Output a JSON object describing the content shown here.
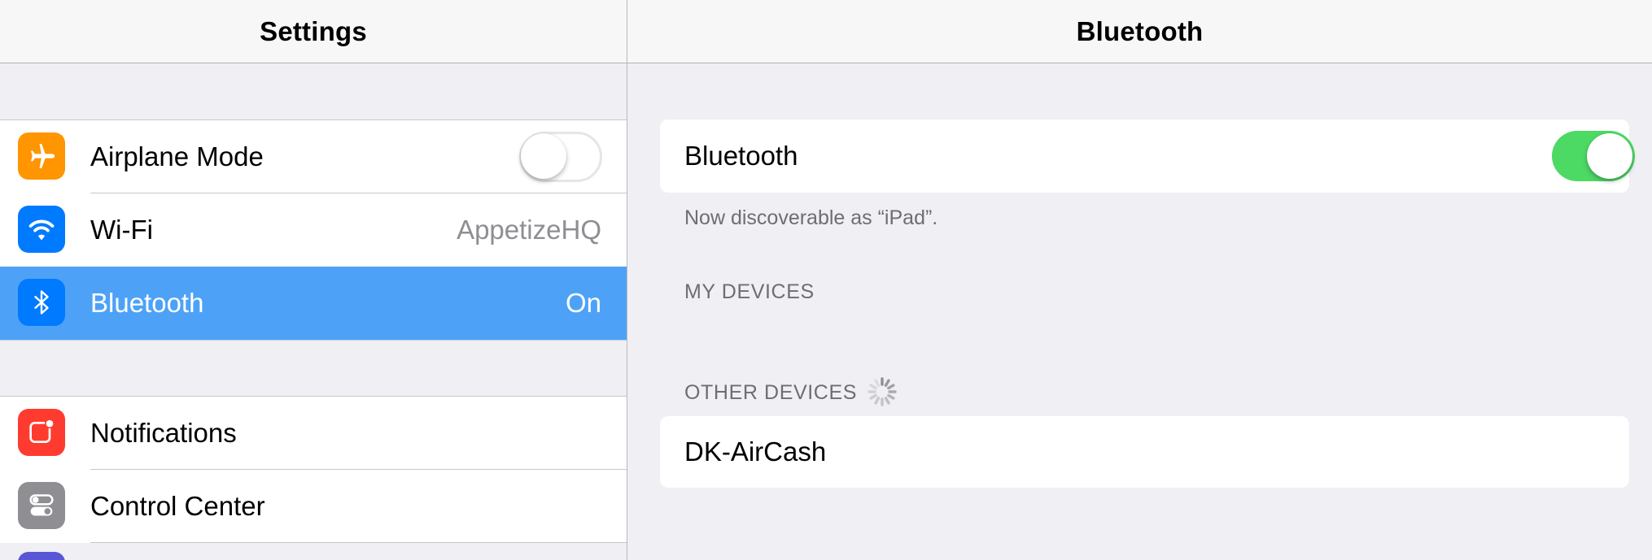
{
  "master": {
    "title": "Settings",
    "groups": [
      {
        "items": [
          {
            "label": "Airplane Mode",
            "icon": "airplane-icon",
            "icon_color": "#ff9500",
            "toggle": false
          },
          {
            "label": "Wi-Fi",
            "icon": "wifi-icon",
            "icon_color": "#007aff",
            "value": "AppetizeHQ"
          },
          {
            "label": "Bluetooth",
            "icon": "bluetooth-icon",
            "icon_color": "#007aff",
            "value": "On",
            "selected": true
          }
        ]
      },
      {
        "items": [
          {
            "label": "Notifications",
            "icon": "notifications-icon",
            "icon_color": "#ff3b30"
          },
          {
            "label": "Control Center",
            "icon": "control-center-icon",
            "icon_color": "#8e8e93"
          }
        ]
      }
    ],
    "selected_color": "#4da2f7"
  },
  "detail": {
    "title": "Bluetooth",
    "bluetooth_row": {
      "label": "Bluetooth",
      "toggle": true
    },
    "discoverable_text": "Now discoverable as “iPad”.",
    "my_devices_header": "MY DEVICES",
    "other_devices_header": "OTHER DEVICES",
    "other_devices": [
      "DK-AirCash"
    ],
    "toggle_on_color": "#4cd964"
  }
}
